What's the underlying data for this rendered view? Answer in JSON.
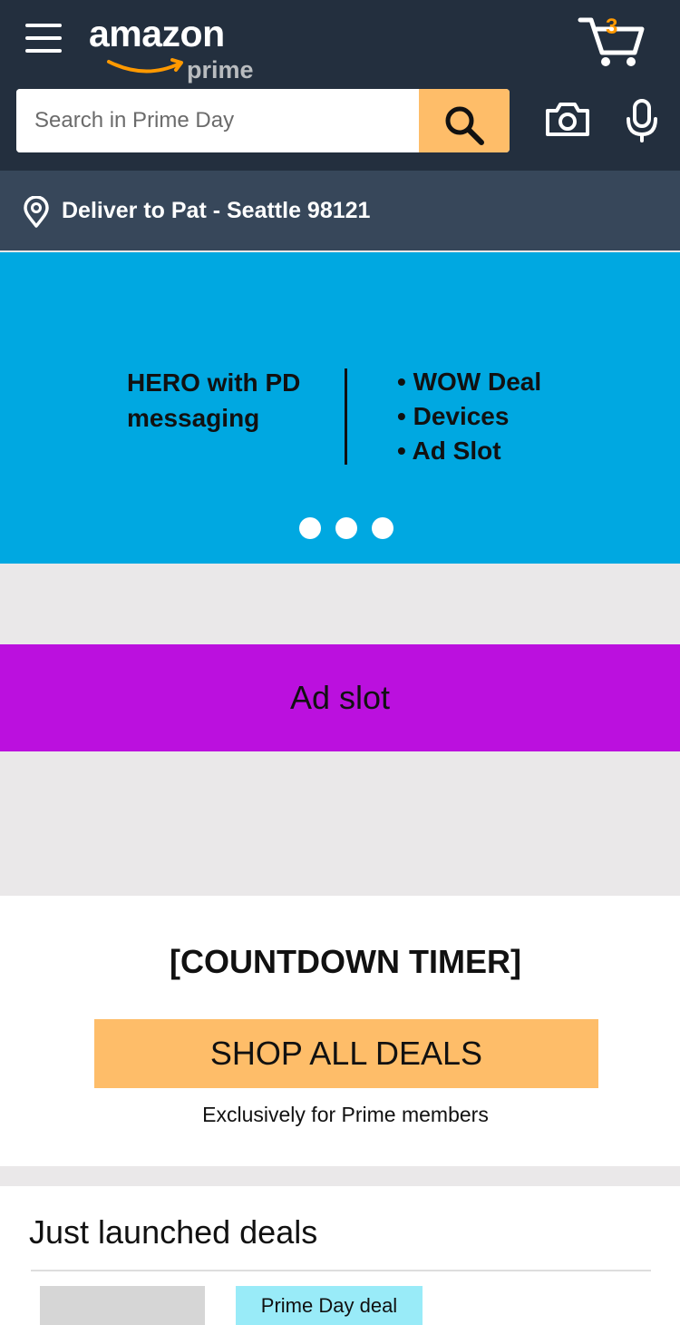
{
  "header": {
    "logo_primary": "amazon",
    "logo_secondary": "prime",
    "cart_count": "3",
    "search_placeholder": "Search in Prime Day",
    "icons": [
      "menu-icon",
      "cart-icon",
      "search-icon",
      "camera-icon",
      "microphone-icon"
    ]
  },
  "deliver": {
    "label": "Deliver to Pat - Seattle 98121",
    "icon": "location-pin-icon"
  },
  "hero": {
    "left_line1": "HERO with PD",
    "left_line2": "messaging",
    "bullets": [
      "WOW Deal",
      "Devices",
      "Ad Slot"
    ],
    "dot_count": 3
  },
  "ad_slot": {
    "label": "Ad slot"
  },
  "countdown": {
    "title": "[COUNTDOWN TIMER]",
    "button_label": "SHOP ALL DEALS",
    "subtitle": "Exclusively for Prime members"
  },
  "deals": {
    "title": "Just launched deals",
    "badge": "Prime Day deal"
  },
  "colors": {
    "header_bg": "#232f3e",
    "deliver_bg": "#37475a",
    "accent_orange": "#febd69",
    "hero_bg": "#00a8e1",
    "ad_bg": "#bb10de",
    "badge_bg": "#99ebf8",
    "page_bg": "#eae8e9"
  }
}
